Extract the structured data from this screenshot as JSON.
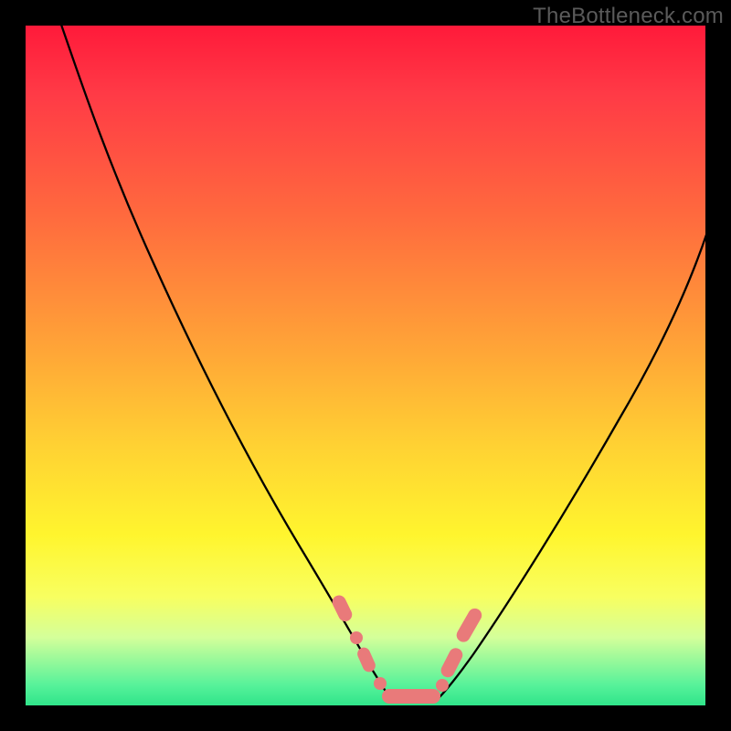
{
  "watermark": "TheBottleneck.com",
  "colors": {
    "frame": "#000000",
    "gradient_stops": [
      "#ff1a3a",
      "#ff3a46",
      "#ff6a3e",
      "#ffa637",
      "#ffd233",
      "#fff52e",
      "#f8ff60",
      "#d4ff9a",
      "#57f29a",
      "#30e48a"
    ],
    "curve": "#000000",
    "markers": "#e97a7a"
  },
  "chart_data": {
    "type": "line",
    "title": "",
    "xlabel": "",
    "ylabel": "",
    "xlim": [
      0,
      100
    ],
    "ylim": [
      0,
      100
    ],
    "note": "Bottleneck-style V curve; y≈0 near x≈53–60 (optimal zone). No numeric axes rendered in image; values are estimates from geometry.",
    "series": [
      {
        "name": "left-branch",
        "x": [
          5,
          12,
          20,
          28,
          36,
          44,
          48,
          51,
          53
        ],
        "y": [
          100,
          88,
          74,
          60,
          45,
          29,
          17,
          7,
          2
        ]
      },
      {
        "name": "right-branch",
        "x": [
          60,
          64,
          70,
          78,
          86,
          94,
          100
        ],
        "y": [
          2,
          8,
          19,
          35,
          53,
          70,
          82
        ]
      },
      {
        "name": "optimal-flat",
        "x": [
          53,
          55,
          57,
          59,
          60
        ],
        "y": [
          1,
          0.5,
          0.5,
          0.5,
          1
        ]
      }
    ],
    "markers": [
      {
        "name": "left-upper-capsule",
        "x_range": [
          45.5,
          46.5
        ],
        "y_range": [
          20,
          24
        ]
      },
      {
        "name": "left-mid-dot",
        "x": 48,
        "y": 15
      },
      {
        "name": "left-lower-capsule",
        "x_range": [
          49,
          50
        ],
        "y_range": [
          8,
          12
        ]
      },
      {
        "name": "flat-capsule",
        "x_range": [
          51,
          60
        ],
        "y_range": [
          0.5,
          2
        ]
      },
      {
        "name": "right-lower-capsule",
        "x_range": [
          61.5,
          63
        ],
        "y_range": [
          6,
          12
        ]
      },
      {
        "name": "right-upper-capsule",
        "x_range": [
          63.5,
          65.5
        ],
        "y_range": [
          13,
          20
        ]
      }
    ]
  }
}
